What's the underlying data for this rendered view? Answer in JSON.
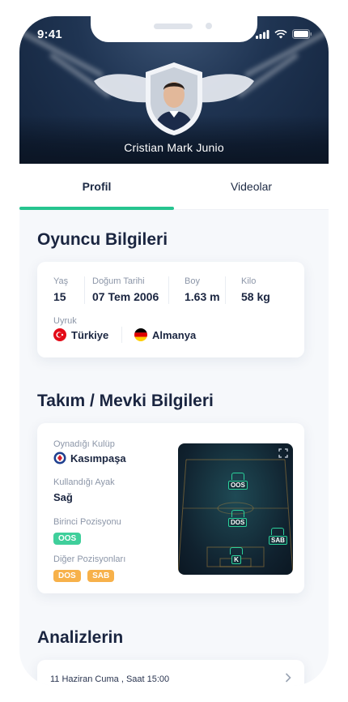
{
  "status": {
    "time": "9:41"
  },
  "profile": {
    "name": "Cristian Mark Junio"
  },
  "tabs": [
    {
      "label": "Profil",
      "active": true
    },
    {
      "label": "Videolar",
      "active": false
    }
  ],
  "player_info": {
    "title": "Oyuncu Bilgileri",
    "age": {
      "label": "Yaş",
      "value": "15"
    },
    "birth_date": {
      "label": "Doğum Tarihi",
      "value": "07 Tem 2006"
    },
    "height": {
      "label": "Boy",
      "value": "1.63 m"
    },
    "weight": {
      "label": "Kilo",
      "value": "58 kg"
    },
    "nationality": {
      "label": "Uyruk",
      "countries": [
        "Türkiye",
        "Almanya"
      ]
    }
  },
  "team_info": {
    "title": "Takım / Mevki Bilgileri",
    "club": {
      "label": "Oynadığı Kulüp",
      "value": "Kasımpaşa"
    },
    "foot": {
      "label": "Kullandığı Ayak",
      "value": "Sağ"
    },
    "primary_position": {
      "label": "Birinci Pozisyonu",
      "value": "OOS"
    },
    "other_positions": {
      "label": "Diğer Pozisyonları",
      "values": [
        "DOS",
        "SAB"
      ]
    },
    "pitch_markers": [
      "OOS",
      "DOS",
      "SAB",
      "K"
    ]
  },
  "analyses": {
    "title": "Analizlerin",
    "items": [
      {
        "date": "11 Haziran Cuma , Saat 15:00"
      }
    ]
  },
  "colors": {
    "accent": "#26c48f",
    "secondary_pill": "#f7b14a",
    "heading": "#1a2540"
  }
}
